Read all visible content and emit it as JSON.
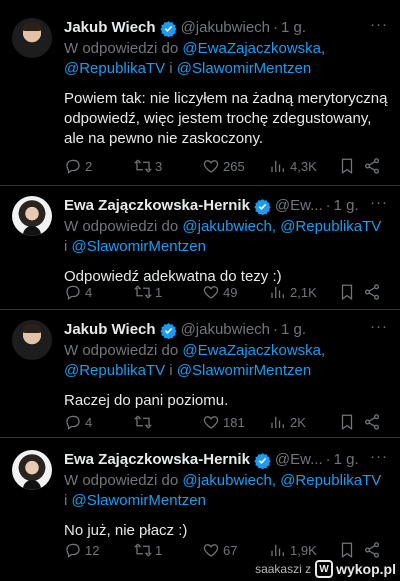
{
  "tweets": [
    {
      "name": "Jakub Wiech",
      "handle": "@jakubwiech",
      "sep": "·",
      "time": "1 g.",
      "reply_prefix": "W odpowiedzi do ",
      "mentions": [
        "@EwaZajaczkowska,",
        "@RepublikaTV",
        "@SlawomirMentzen"
      ],
      "reply_and": " i ",
      "text": "Powiem tak: nie liczyłem na żadną merytoryczną odpowiedź, więc jestem trochę zdegustowany, ale na pewno nie zaskoczony.",
      "replies": "2",
      "retweets": "3",
      "likes": "265",
      "views": "4,3K"
    },
    {
      "name": "Ewa Zajączkowska-Hernik",
      "handle": "@Ew...",
      "sep": "·",
      "time": "1 g.",
      "reply_prefix": "W odpowiedzi do ",
      "mentions": [
        "@jakubwiech,",
        "@RepublikaTV",
        "@SlawomirMentzen"
      ],
      "reply_and": "i ",
      "text": "Odpowiedź adekwatna do tezy :)",
      "replies": "4",
      "retweets": "1",
      "likes": "49",
      "views": "2,1K"
    },
    {
      "name": "Jakub Wiech",
      "handle": "@jakubwiech",
      "sep": "·",
      "time": "1 g.",
      "reply_prefix": "W odpowiedzi do ",
      "mentions": [
        "@EwaZajaczkowska,",
        "@RepublikaTV",
        "@SlawomirMentzen"
      ],
      "reply_and": " i ",
      "text": "Raczej do pani poziomu.",
      "replies": "4",
      "retweets": "",
      "likes": "181",
      "views": "2K"
    },
    {
      "name": "Ewa Zajączkowska-Hernik",
      "handle": "@Ew...",
      "sep": "·",
      "time": "1 g.",
      "reply_prefix": "W odpowiedzi do ",
      "mentions": [
        "@jakubwiech,",
        "@RepublikaTV",
        "@SlawomirMentzen"
      ],
      "reply_and": "i ",
      "text": "No już, nie płacz :)",
      "replies": "12",
      "retweets": "1",
      "likes": "67",
      "views": "1,9K"
    }
  ],
  "more_label": "···",
  "footer": {
    "user": "saakaszi z",
    "site": "wykop.pl"
  },
  "colors": {
    "background": "#000000",
    "text": "#e7e9ea",
    "muted": "#71767b",
    "link": "#1d9bf0",
    "verified": "#1d9bf0"
  },
  "icons": [
    "verified-badge-icon",
    "reply-icon",
    "retweet-icon",
    "like-icon",
    "views-icon",
    "bookmark-icon",
    "share-icon",
    "more-icon",
    "wykop-logo-icon"
  ]
}
